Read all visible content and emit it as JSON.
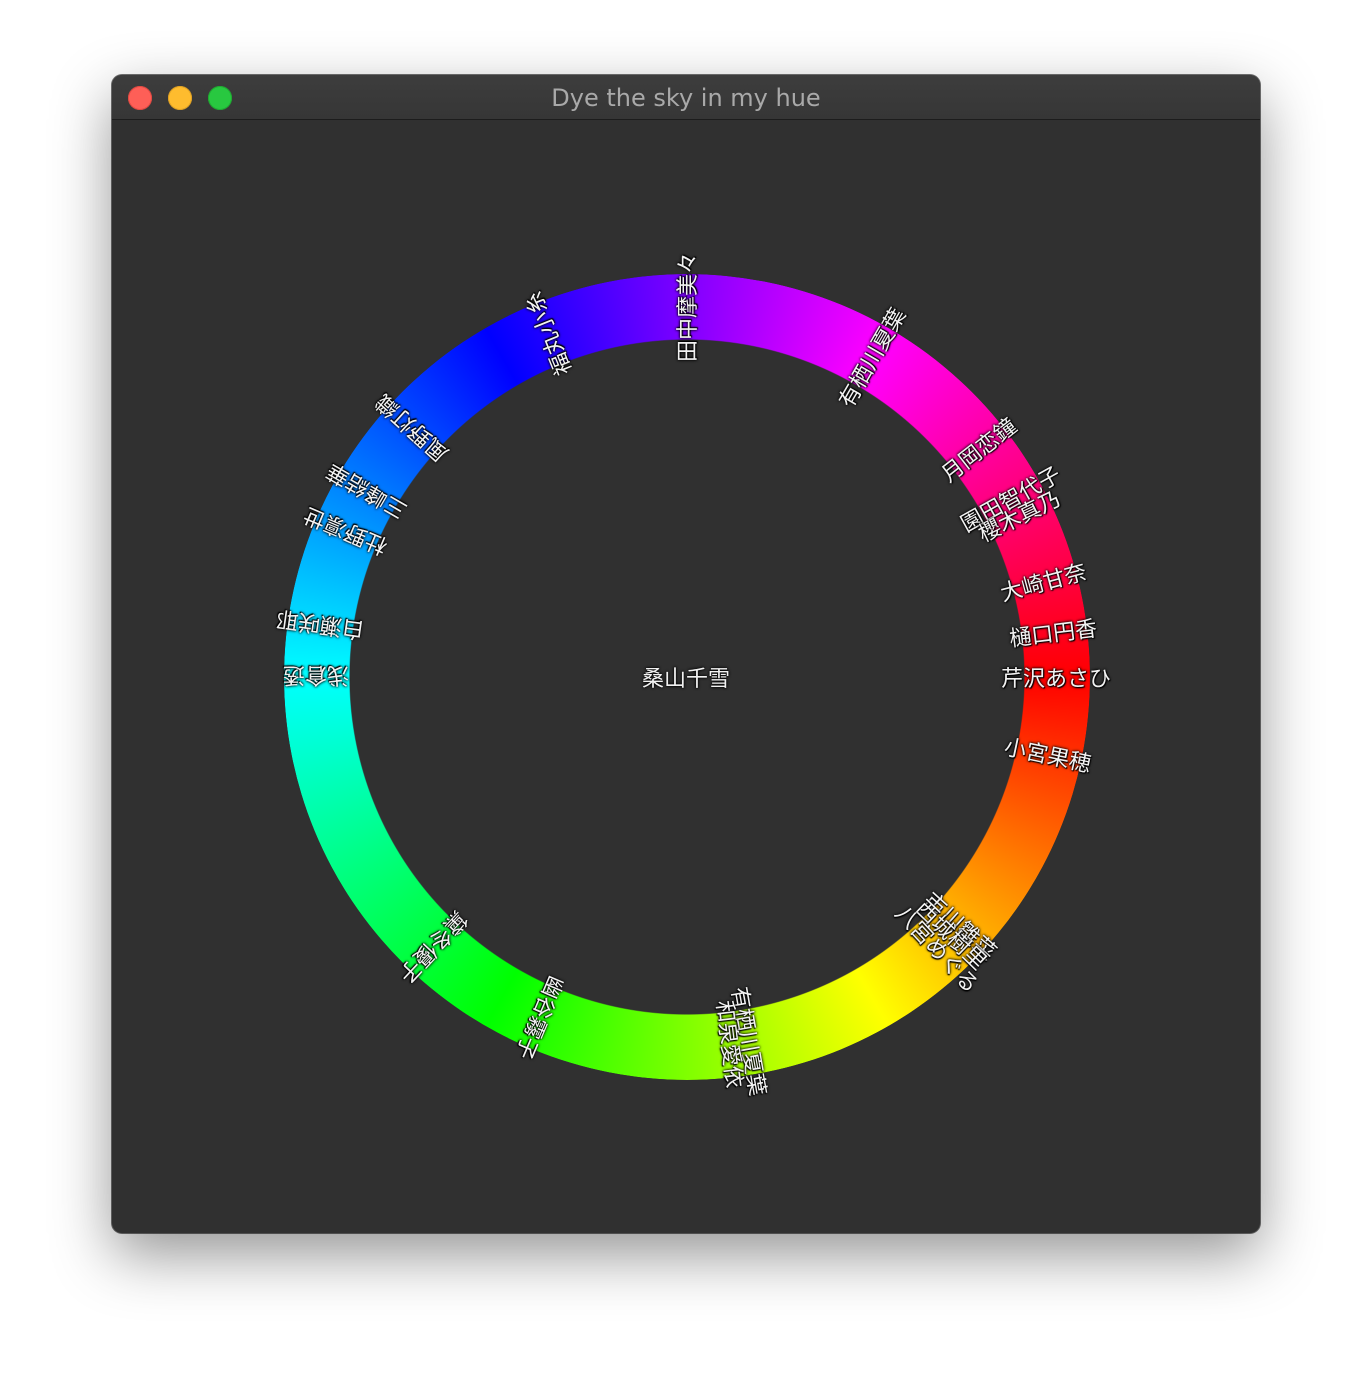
{
  "window": {
    "title": "Dye the sky in my hue"
  },
  "center_label": "桑山千雪",
  "ring_labels": [
    "芹沢あさひ",
    "小宮果穂",
    "市川雛菜",
    "西城樹里",
    "八宮めぐる",
    "有栖川夏葉",
    "浅倉透",
    "杜野凛世",
    "幽谷霧子",
    "白瀬咲耶",
    "黛冬優子",
    "三峰結華",
    "和泉愛依",
    "風野灯織",
    "福丸小糸",
    "田中摩美々",
    "有栖川夏葉",
    "月岡恋鐘",
    "園田智代子",
    "櫻木真乃",
    "大崎甘奈",
    "樋口円香"
  ],
  "colors": {
    "window_background": "#303030",
    "titlebar": "#383838",
    "title_text": "#a9a9a9",
    "label_text": "#f2f2f2",
    "close": "#fe5f57",
    "minimize": "#febc2e",
    "maximize": "#28c840",
    "hue_stops": [
      "#ff0000",
      "#ffff00",
      "#00ff00",
      "#00ffff",
      "#0000ff",
      "#ff00ff",
      "#ff0000"
    ]
  },
  "icons": [
    "close-button-icon",
    "minimize-button-icon",
    "zoom-button-icon"
  ]
}
